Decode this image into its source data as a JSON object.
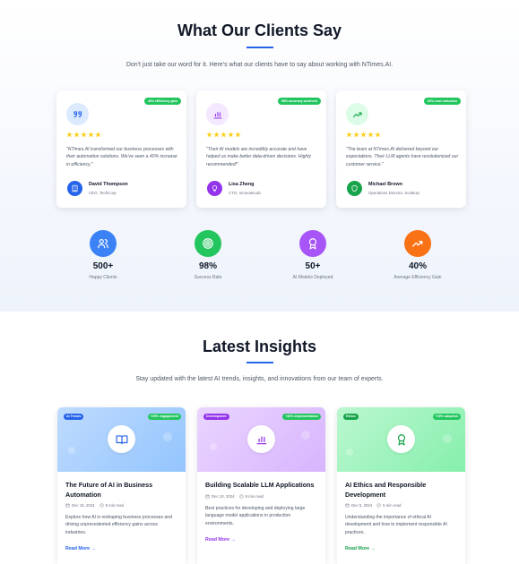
{
  "testimonials": {
    "title": "What Our Clients Say",
    "subtitle": "Don't just take our word for it. Here's what our clients have to say about working with NTimes.AI.",
    "cards": [
      {
        "badge": "40% efficiency gain",
        "icon": "quote-icon",
        "quote": "\"NTimes.AI transformed our business processes with their automation solutions. We've seen a 40% increase in efficiency.\"",
        "name": "David Thompson",
        "role": "CEO, TechCorp",
        "rating": 5,
        "accent": "#2563eb"
      },
      {
        "badge": "98% accuracy achieved",
        "icon": "bar-chart-icon",
        "quote": "\"Their AI models are incredibly accurate and have helped us make better data-driven decisions. Highly recommended!\"",
        "name": "Lisa Zheng",
        "role": "CTO, InnovateLab",
        "rating": 5,
        "accent": "#9333ea"
      },
      {
        "badge": "60% cost reduction",
        "icon": "trending-up-icon",
        "quote": "\"The team at NTimes.AI delivered beyond our expectations. Their LLM agents have revolutionized our customer service.\"",
        "name": "Michael Brown",
        "role": "Operations Director, ScaleUp",
        "rating": 5,
        "accent": "#16a34a"
      }
    ]
  },
  "stats": [
    {
      "value": "500+",
      "label": "Happy Clients",
      "icon": "users-icon",
      "color": "#3b82f6"
    },
    {
      "value": "98%",
      "label": "Success Rate",
      "icon": "target-icon",
      "color": "#22c55e"
    },
    {
      "value": "50+",
      "label": "AI Models Deployed",
      "icon": "award-icon",
      "color": "#a855f7"
    },
    {
      "value": "40%",
      "label": "Average Efficiency Gain",
      "icon": "trending-up-icon",
      "color": "#f97316"
    }
  ],
  "insights": {
    "title": "Latest Insights",
    "subtitle": "Stay updated with the latest AI trends, insights, and innovations from our team of experts.",
    "posts": [
      {
        "category": "AI Trends",
        "metric": "+25% engagement",
        "title": "The Future of AI in Business Automation",
        "date": "Dec 15, 2024",
        "read_time": "5 min read",
        "excerpt": "Explore how AI is reshaping business processes and driving unprecedented efficiency gains across industries.",
        "link": "Read More",
        "icon": "book-icon",
        "accent": "#2563eb"
      },
      {
        "category": "Development",
        "metric": "+40% implementation",
        "title": "Building Scalable LLM Applications",
        "date": "Dec 10, 2024",
        "read_time": "8 min read",
        "excerpt": "Best practices for developing and deploying large language model applications in production environments.",
        "link": "Read More",
        "icon": "bar-chart-icon",
        "accent": "#9333ea"
      },
      {
        "category": "Ethics",
        "metric": "+30% adoption",
        "title": "AI Ethics and Responsible Development",
        "date": "Dec 5, 2024",
        "read_time": "6 min read",
        "excerpt": "Understanding the importance of ethical AI development and how to implement responsible AI practices.",
        "link": "Read More",
        "icon": "award-icon",
        "accent": "#16a34a"
      }
    ]
  }
}
